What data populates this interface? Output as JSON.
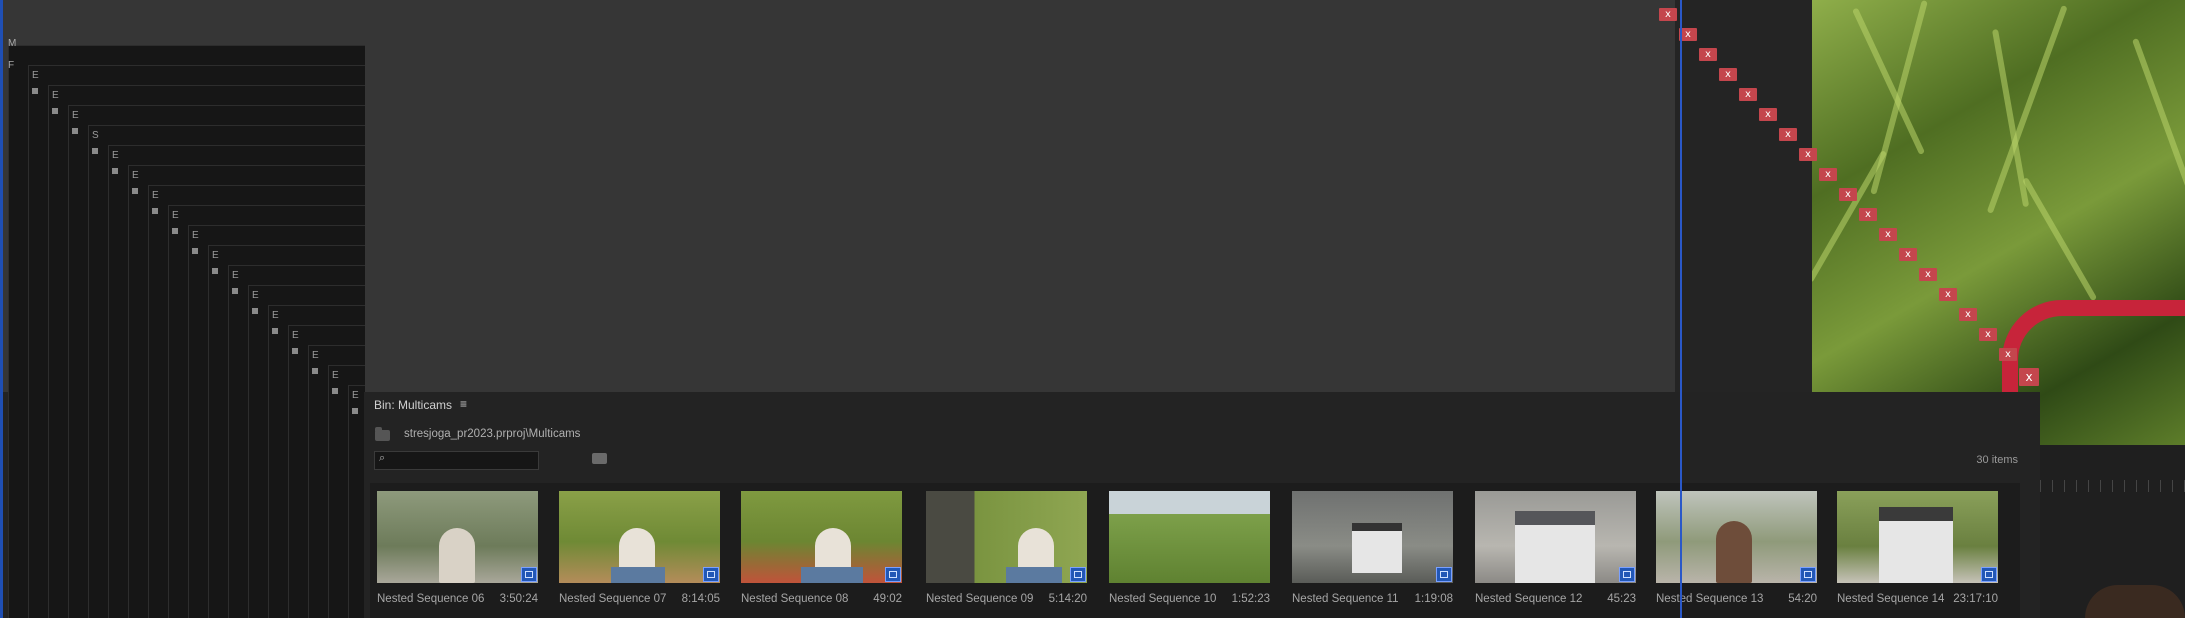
{
  "left_panel": {
    "glyphs": [
      "M",
      "F"
    ]
  },
  "stacked_windows": {
    "labels": [
      "E",
      "E",
      "E",
      "S",
      "E",
      "E",
      "E",
      "E",
      "E",
      "E",
      "E",
      "E",
      "E",
      "E",
      "E",
      "E",
      "E"
    ]
  },
  "close_button": {
    "label": "x"
  },
  "bin": {
    "title": "Bin: Multicams",
    "menu_icon": "≡",
    "path": "stresjoga_pr2023.prproj\\Multicams",
    "search": {
      "value": "",
      "placeholder": ""
    },
    "item_count": "30 items",
    "items": [
      {
        "name": "Nested Sequence 06",
        "duration": "3:50:24"
      },
      {
        "name": "Nested Sequence 07",
        "duration": "8:14:05"
      },
      {
        "name": "Nested Sequence 08",
        "duration": "49:02"
      },
      {
        "name": "Nested Sequence 09",
        "duration": "5:14:20"
      },
      {
        "name": "Nested Sequence 10",
        "duration": "1:52:23"
      },
      {
        "name": "Nested Sequence 11",
        "duration": "1:19:08"
      },
      {
        "name": "Nested Sequence 12",
        "duration": "45:23"
      },
      {
        "name": "Nested Sequence 13",
        "duration": "54:20"
      },
      {
        "name": "Nested Sequence 14",
        "duration": "23:17:10"
      }
    ]
  },
  "icons": {
    "bin_menu": "hamburger-menu-icon",
    "folder": "folder-up-icon",
    "search": "search-icon",
    "find": "find-icon",
    "multicam": "multicam-badge-icon",
    "close": "close-icon"
  },
  "colors": {
    "close_button": "#c4464d",
    "playhead": "#2a58c8",
    "multicam_badge": "#2257b6",
    "panel_bg": "#232323"
  }
}
